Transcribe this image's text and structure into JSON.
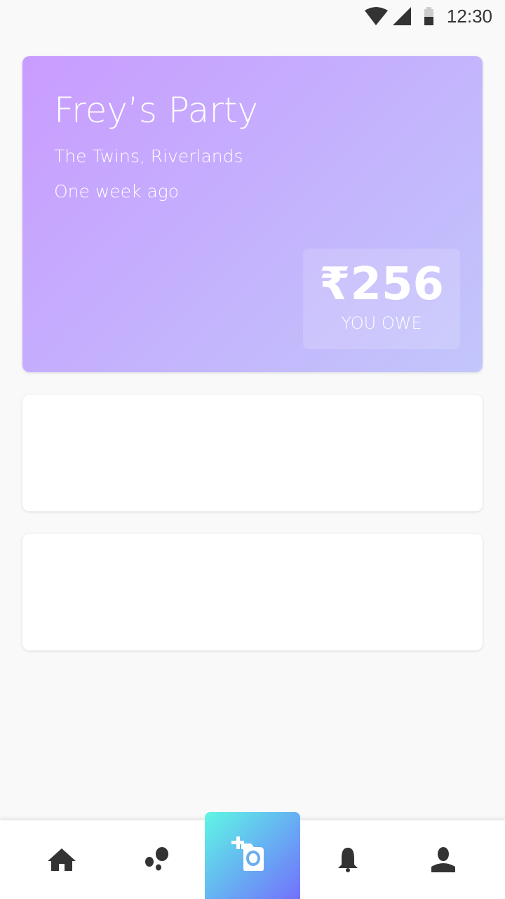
{
  "status_bar": {
    "time": "12:30",
    "icons": [
      "wifi-icon",
      "signal-icon",
      "battery-icon"
    ]
  },
  "event": {
    "title": "Frey’s Party",
    "location": "The Twins, Riverlands",
    "time_ago": "One week ago",
    "amount": "₹256",
    "amount_label": "YOU OWE"
  },
  "nav": {
    "items": [
      "home-icon",
      "groups-icon",
      "add-photo-icon",
      "notifications-icon",
      "profile-icon"
    ],
    "accent_gradient": [
      "#5ff7e4",
      "#7370fc"
    ]
  }
}
